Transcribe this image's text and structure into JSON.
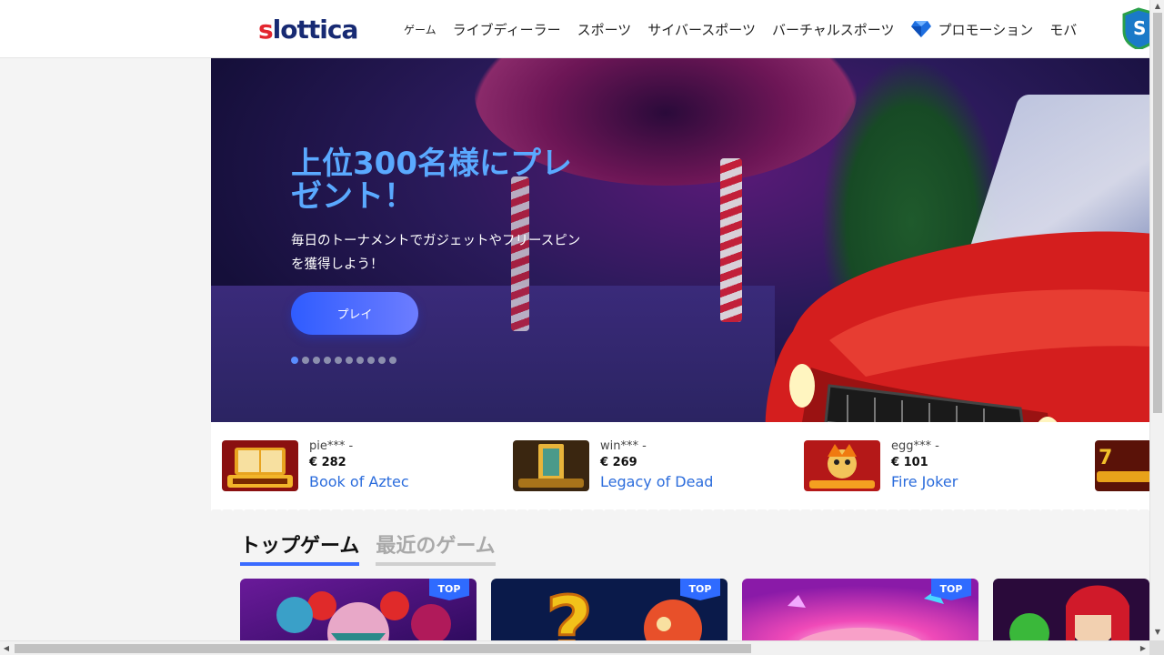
{
  "header": {
    "logo_first": "s",
    "logo_rest": "lottica",
    "nav": [
      {
        "label": "ゲーム"
      },
      {
        "label": "ライブディーラー"
      },
      {
        "label": "スポーツ"
      },
      {
        "label": "サイバースポーツ"
      },
      {
        "label": "バーチャルスポーツ"
      },
      {
        "label": "プロモーション",
        "icon": "diamond-icon"
      },
      {
        "label": "モバ"
      }
    ]
  },
  "hero": {
    "title": "上位300名様にプレゼント！",
    "subtitle": "毎日のトーナメントでガジェットやフリースピンを獲得しよう！",
    "button": "プレイ",
    "slides_total": 10,
    "active_slide": 1
  },
  "winners": [
    {
      "user": "pie*** -",
      "amount": "€ 282",
      "game": "Book of Aztec"
    },
    {
      "user": "win*** -",
      "amount": "€ 269",
      "game": "Legacy of Dead"
    },
    {
      "user": "egg*** -",
      "amount": "€ 101",
      "game": "Fire Joker"
    },
    {
      "user": "",
      "amount": "",
      "game": ""
    }
  ],
  "tabs": {
    "top": "トップゲーム",
    "recent": "最近のゲーム"
  },
  "cards": [
    {
      "badge": "TOP"
    },
    {
      "badge": "TOP"
    },
    {
      "badge": "TOP"
    },
    {
      "badge": ""
    }
  ],
  "colors": {
    "accent": "#3a6bff",
    "link": "#2b6cdc",
    "hero_title": "#5aa9ff",
    "logo_red": "#e3262f",
    "logo_navy": "#172a73"
  }
}
